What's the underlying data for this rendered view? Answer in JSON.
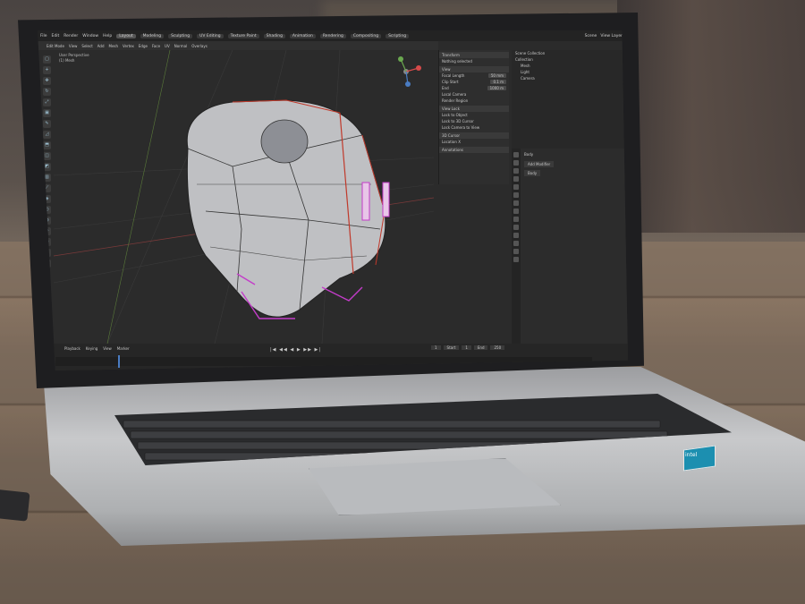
{
  "topbar": {
    "menus": [
      "File",
      "Edit",
      "Render",
      "Window",
      "Help"
    ],
    "workspaces": [
      "Layout",
      "Modeling",
      "Sculpting",
      "UV Editing",
      "Texture Paint",
      "Shading",
      "Animation",
      "Rendering",
      "Compositing",
      "Scripting"
    ],
    "active_workspace": "Layout",
    "scene": "Scene",
    "view_layer": "View Layer"
  },
  "viewport_header": {
    "mode": "Edit Mode",
    "menus": [
      "View",
      "Select",
      "Add",
      "Mesh",
      "Vertex",
      "Edge",
      "Face",
      "UV"
    ],
    "orientation": "Normal",
    "overlays": "Overlays"
  },
  "viewport_info": {
    "line1": "User Perspective",
    "line2": "(1) Mesh"
  },
  "npanel": {
    "transform": "Transform",
    "nothing_selected": "Nothing selected",
    "view": "View",
    "focal_length_label": "Focal Length",
    "focal_length_value": "50 mm",
    "clip_start_label": "Clip Start",
    "clip_start_value": "0.1 m",
    "clip_end_label": "End",
    "clip_end_value": "1000 m",
    "local_camera": "Local Camera",
    "render_region": "Render Region",
    "view_lock": "View Lock",
    "lock_to_object": "Lock to Object",
    "lock_to_cursor": "Lock to 3D Cursor",
    "lock_camera": "Lock Camera to View",
    "cursor": "3D Cursor",
    "location": "Location X",
    "annotations": "Annotations",
    "tab_label": "View"
  },
  "outliner": {
    "title": "Scene Collection",
    "items": [
      "Collection",
      "Mesh",
      "Light",
      "Camera"
    ]
  },
  "properties": {
    "object_name": "Body",
    "add_modifier": "Add Modifier",
    "sub_label": "Body"
  },
  "timeline": {
    "menus": [
      "Playback",
      "Keying",
      "View",
      "Marker"
    ],
    "controls": "|◀ ◀◀ ◀ ▶ ▶▶ ▶|",
    "current_frame": "1",
    "start_label": "Start",
    "start": "1",
    "end_label": "End",
    "end": "250"
  },
  "colors": {
    "accent": "#4a7cc2",
    "edge_red": "#c0392b",
    "select_magenta": "#c33cc9",
    "mesh": "#bfc0c3"
  },
  "laptop_badge": "intel"
}
